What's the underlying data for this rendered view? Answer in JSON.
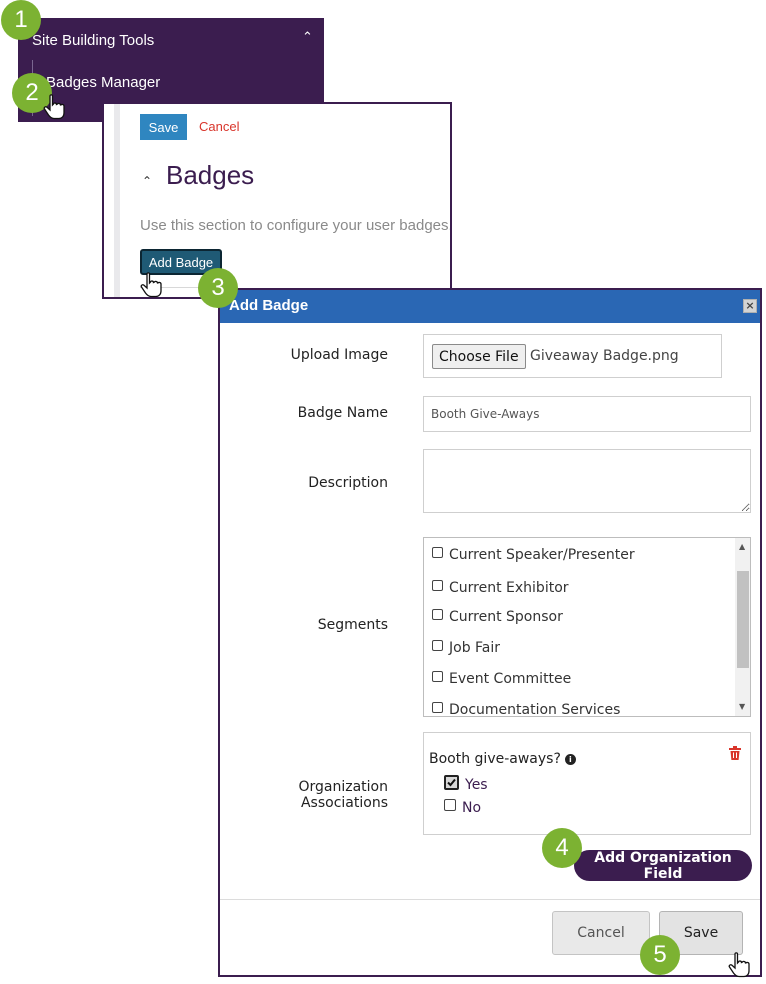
{
  "steps": [
    "1",
    "2",
    "3",
    "4",
    "5"
  ],
  "menu": {
    "title": "Site Building Tools",
    "item": "Badges Manager"
  },
  "section": {
    "save_label": "Save",
    "cancel_label": "Cancel",
    "title": "Badges",
    "description": "Use this section to configure your user badges.",
    "add_badge_label": "Add Badge"
  },
  "modal": {
    "title": "Add Badge",
    "close_icon": "close-icon",
    "upload_label": "Upload Image",
    "choose_file_label": "Choose File",
    "file_name": "Giveaway Badge.png",
    "badge_name_label": "Badge Name",
    "badge_name_value": "Booth Give-Aways",
    "description_label": "Description",
    "segments_label": "Segments",
    "segments": [
      "Current Speaker/Presenter",
      "Current Exhibitor",
      "Current Sponsor",
      "Job Fair",
      "Event Committee",
      "Documentation Services"
    ],
    "org_label_line1": "Organization",
    "org_label_line2": "Associations",
    "org_question": "Booth give-aways?",
    "org_options": [
      "Yes",
      "No"
    ],
    "org_selected": "Yes",
    "add_org_field_label": "Add Organization Field",
    "cancel_label": "Cancel",
    "save_label": "Save"
  },
  "colors": {
    "brand_purple": "#3b1d4f",
    "header_blue": "#2a67b4",
    "step_green": "#7cb232",
    "delete_red": "#d9352b"
  }
}
